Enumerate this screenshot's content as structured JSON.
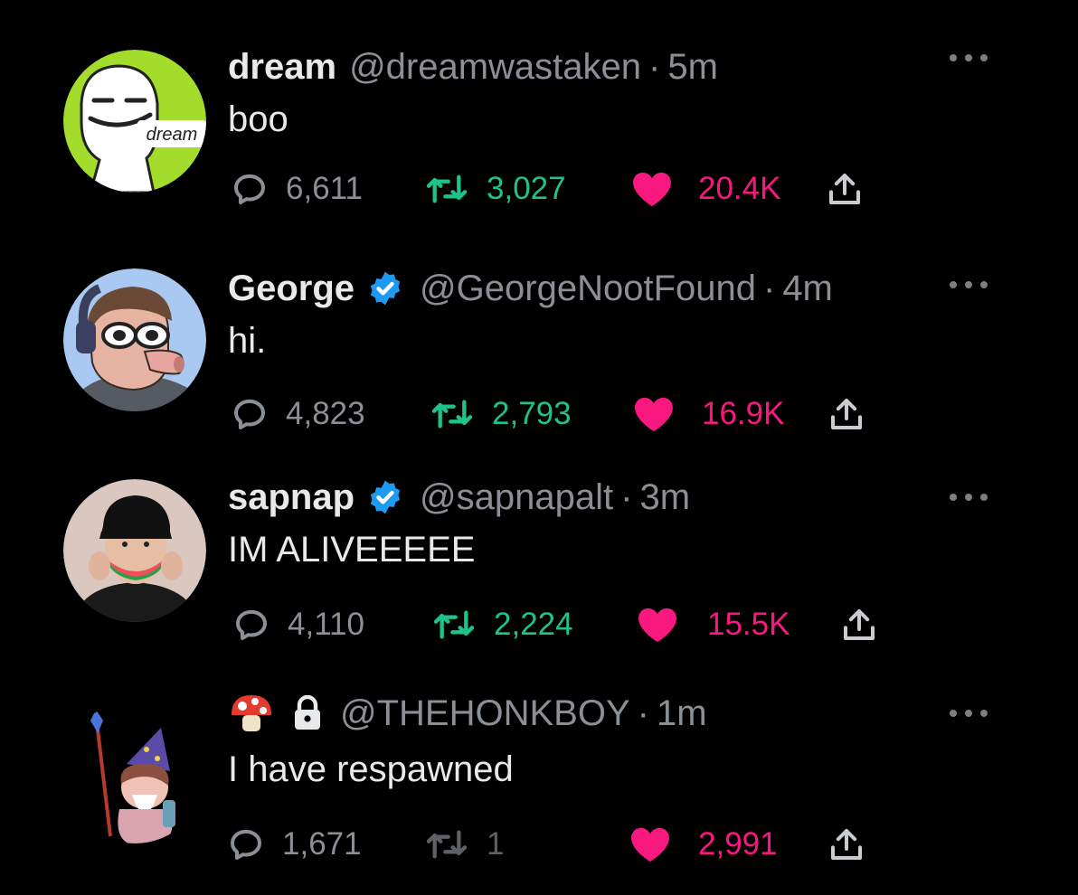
{
  "tweets": [
    {
      "display_name": "dream",
      "handle": "@dreamwastaken",
      "separator": "·",
      "time": "5m",
      "text": "boo",
      "verified": false,
      "avatar_label": "dream",
      "replies": "6,611",
      "retweets": "3,027",
      "likes": "20.4K"
    },
    {
      "display_name": "George",
      "handle": "@GeorgeNootFound",
      "separator": "·",
      "time": "4m",
      "text": "hi.",
      "verified": true,
      "replies": "4,823",
      "retweets": "2,793",
      "likes": "16.9K"
    },
    {
      "display_name": "sapnap",
      "handle": "@sapnapalt",
      "separator": "·",
      "time": "3m",
      "text": "IM ALIVEEEEE",
      "verified": true,
      "replies": "4,110",
      "retweets": "2,224",
      "likes": "15.5K"
    },
    {
      "display_name": "",
      "name_icons": [
        "mushroom-emoji",
        "lock-icon"
      ],
      "handle": "@THEHONKBOY",
      "separator": "·",
      "time": "1m",
      "text": "I have respawned",
      "verified": false,
      "replies": "1,671",
      "retweets": "1",
      "likes": "2,991"
    }
  ],
  "colors": {
    "background": "#000000",
    "text": "#e7e9ea",
    "muted": "#8b9096",
    "retweet": "#1ec28b",
    "like": "#f91880",
    "verified": "#1d9bf0"
  },
  "icons": {
    "reply": "speech-bubble-icon",
    "retweet": "retweet-arrows-icon",
    "like": "heart-icon",
    "share": "share-upload-icon",
    "more": "ellipsis-icon",
    "verified": "verified-badge-icon"
  }
}
